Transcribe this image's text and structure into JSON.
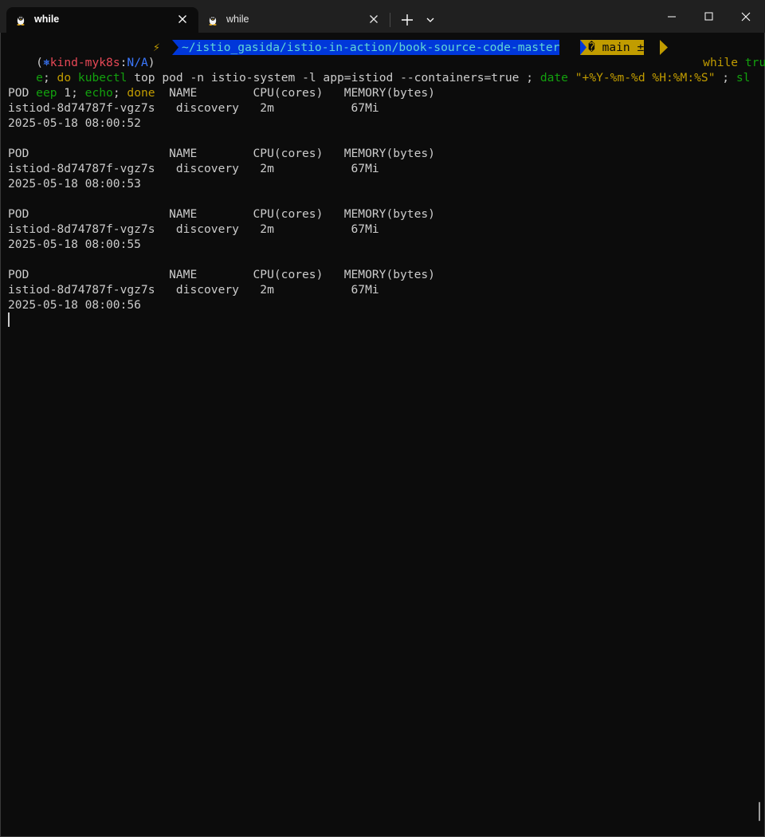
{
  "tabs": [
    {
      "title": "while",
      "active": true,
      "icon": "linux-penguin-icon"
    },
    {
      "title": "while",
      "active": false,
      "icon": "linux-penguin-icon"
    }
  ],
  "window_controls": [
    "minimize-icon",
    "maximize-icon",
    "close-icon"
  ],
  "prompt": {
    "open_paren": "(",
    "k8s_icon": "⎈",
    "context": "kind-myk8s",
    "colon": ":",
    "namespace": "N/A",
    "close_paren": ")",
    "bolt": "⚡",
    "path": "~/istio_gasida/istio-in-action/book-source-code-master",
    "branch": "� main ±"
  },
  "command": {
    "line1": {
      "while": "while",
      "tru": "tru"
    },
    "line2": {
      "e": "e",
      "semi1": "; ",
      "do": "do",
      "kubectl": "kubectl",
      "args": " top pod -n istio-system -l app=istiod --containers=true ; ",
      "date": "date",
      "fmt": " \"+%Y-%m-%d %H:%M:%S\"",
      "semi2": " ; ",
      "sl": "sl"
    },
    "line3": {
      "eep": "eep",
      "arg1": " 1; ",
      "echo": "echo",
      "semi3": "; ",
      "done": "done"
    }
  },
  "output": {
    "header": "POD                    NAME        CPU(cores)   MEMORY(bytes)",
    "blocks": [
      {
        "row": "istiod-8d74787f-vgz7s   discovery   2m           67Mi",
        "timestamp": "2025-05-18 08:00:52"
      },
      {
        "row": "istiod-8d74787f-vgz7s   discovery   2m           67Mi",
        "timestamp": "2025-05-18 08:00:53"
      },
      {
        "row": "istiod-8d74787f-vgz7s   discovery   2m           67Mi",
        "timestamp": "2025-05-18 08:00:55"
      },
      {
        "row": "istiod-8d74787f-vgz7s   discovery   2m           67Mi",
        "timestamp": "2025-05-18 08:00:56"
      }
    ]
  },
  "colors": {
    "background": "#0c0c0c",
    "titlebar": "#202020",
    "path_segment": "#0037da",
    "branch_segment": "#c19c00",
    "keyword": "#c19c00",
    "command": "#13a10e"
  }
}
